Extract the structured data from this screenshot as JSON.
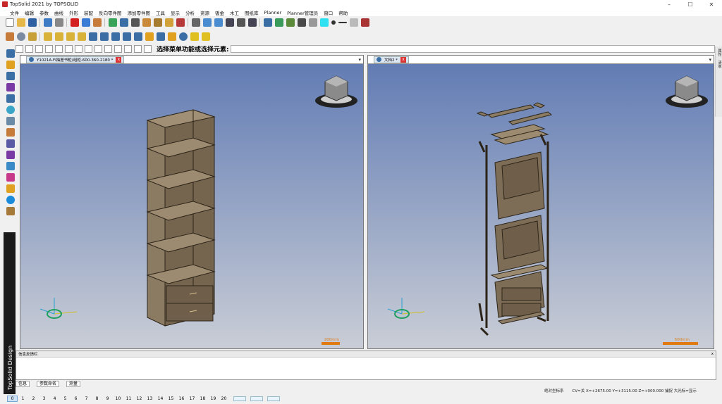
{
  "window": {
    "title": "TopSolid 2021 by TOPSOLID",
    "min": "–",
    "max": "☐",
    "close": "✕"
  },
  "menu": [
    "文件",
    "编辑",
    "参数",
    "曲线",
    "外形",
    "装配",
    "反向零件图",
    "添加零件图",
    "工具",
    "显示",
    "分析",
    "资源",
    "钣金",
    "木工",
    "图纸库",
    "Planner",
    "Planner管理员",
    "窗口",
    "帮助"
  ],
  "command": {
    "prompt": "选择菜单功能或选择元素:",
    "value": ""
  },
  "viewports": [
    {
      "tab_label": "Y1021A-FI抽屉书柜(组柜-600-360-2180 *",
      "close": "x",
      "scale_label": "200mm"
    },
    {
      "tab_label": "文档2 *",
      "close": "x",
      "scale_label": "500mm"
    }
  ],
  "right_strip": [
    "属性",
    "清单"
  ],
  "brand": "TopSolid Design",
  "feedback_panel": {
    "title": "信息反馈栏",
    "close": "x"
  },
  "bottom_tabs": [
    "信息",
    "参数命名",
    "测量"
  ],
  "status": {
    "mode": "绝对坐标系",
    "coords": "CV=关 X=+2675.00 Y=+3115.00 Z=+000.000 捕捉 大光标=显示"
  },
  "pages": [
    "0",
    "1",
    "2",
    "3",
    "4",
    "5",
    "6",
    "7",
    "8",
    "9",
    "10",
    "11",
    "12",
    "13",
    "14",
    "15",
    "16",
    "17",
    "18",
    "19",
    "20"
  ],
  "colors": {
    "viewport_top": "#5f7ab3",
    "viewport_bottom": "#c9cdd6",
    "wood": "#7a6a55",
    "accent": "#e07a10"
  }
}
